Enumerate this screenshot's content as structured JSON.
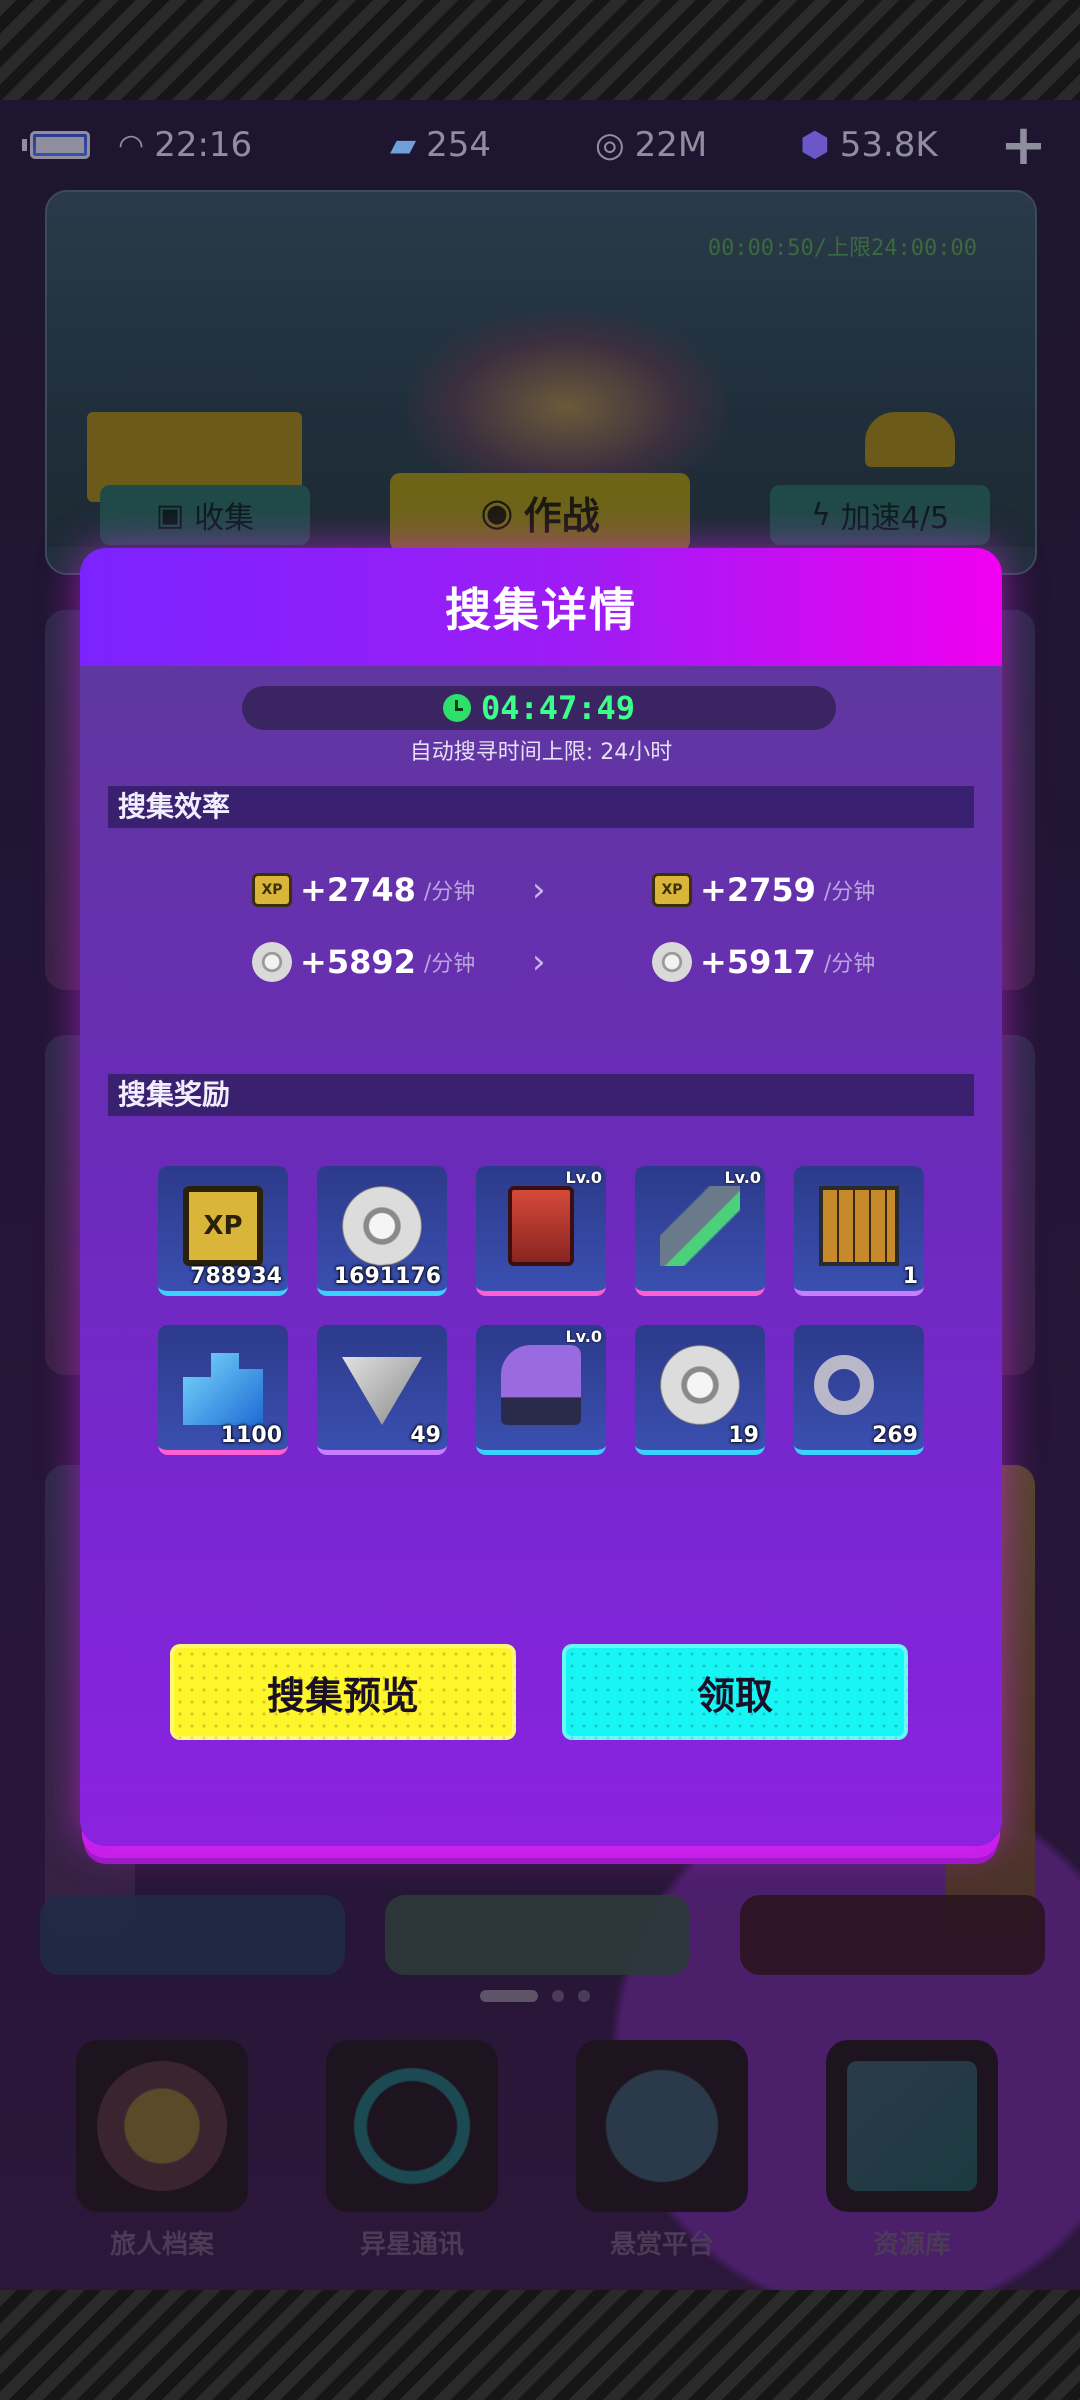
{
  "status_bar": {
    "time": "22:16",
    "resources": [
      {
        "icon": "bandage-icon",
        "value": "254"
      },
      {
        "icon": "coin-icon",
        "value": "22M"
      },
      {
        "icon": "gem-icon",
        "value": "53.8K"
      }
    ],
    "add_label": "+"
  },
  "stage": {
    "timer": "00:00:50/上限24:00:00",
    "tabs": {
      "collect": "收集",
      "battle": "作战",
      "speed": "加速4/5"
    }
  },
  "modal": {
    "title": "搜集详情",
    "countdown": "04:47:49",
    "limit_text": "自动搜寻时间上限: 24小时",
    "efficiency": {
      "label": "搜集效率",
      "unit": "/分钟",
      "rows": [
        {
          "icon": "xp-chip-icon",
          "current": "+2748",
          "next": "+2759"
        },
        {
          "icon": "coin-icon",
          "current": "+5892",
          "next": "+5917"
        }
      ]
    },
    "rewards": {
      "label": "搜集奖励",
      "items": [
        {
          "icon": "xp-chip-icon",
          "count": "788934",
          "lv": "",
          "rarity": "blue"
        },
        {
          "icon": "coin-icon",
          "count": "1691176",
          "lv": "",
          "rarity": "blue"
        },
        {
          "icon": "red-armor-icon",
          "count": "",
          "lv": "Lv.0",
          "rarity": "pink"
        },
        {
          "icon": "green-blade-icon",
          "count": "",
          "lv": "Lv.0",
          "rarity": "pink"
        },
        {
          "icon": "chess-board-icon",
          "count": "1",
          "lv": "",
          "rarity": "purple"
        },
        {
          "icon": "blue-crystal-blocks-icon",
          "count": "1100",
          "lv": "",
          "rarity": "pink"
        },
        {
          "icon": "silver-triangle-icon",
          "count": "49",
          "lv": "",
          "rarity": "purple"
        },
        {
          "icon": "roller-skate-icon",
          "count": "",
          "lv": "Lv.0",
          "rarity": "blue"
        },
        {
          "icon": "coin-icon",
          "count": "19",
          "lv": "",
          "rarity": "blue"
        },
        {
          "icon": "infinity-ring-icon",
          "count": "269",
          "lv": "",
          "rarity": "blue"
        }
      ]
    },
    "buttons": {
      "preview": "搜集预览",
      "claim": "领取"
    }
  },
  "dock": [
    {
      "label": "旅人档案",
      "icon": "traveler-archive-icon"
    },
    {
      "label": "异星通讯",
      "icon": "pacman-comms-icon"
    },
    {
      "label": "悬赏平台",
      "icon": "forum-globe-icon"
    },
    {
      "label": "资源库",
      "icon": "resource-cube-icon"
    }
  ],
  "colors": {
    "accent_magenta": "#f000f0",
    "accent_violet": "#7b23ff",
    "claim_cyan": "#17f5f5",
    "preview_yellow": "#fff52b",
    "countdown_green": "#3bff8a"
  }
}
